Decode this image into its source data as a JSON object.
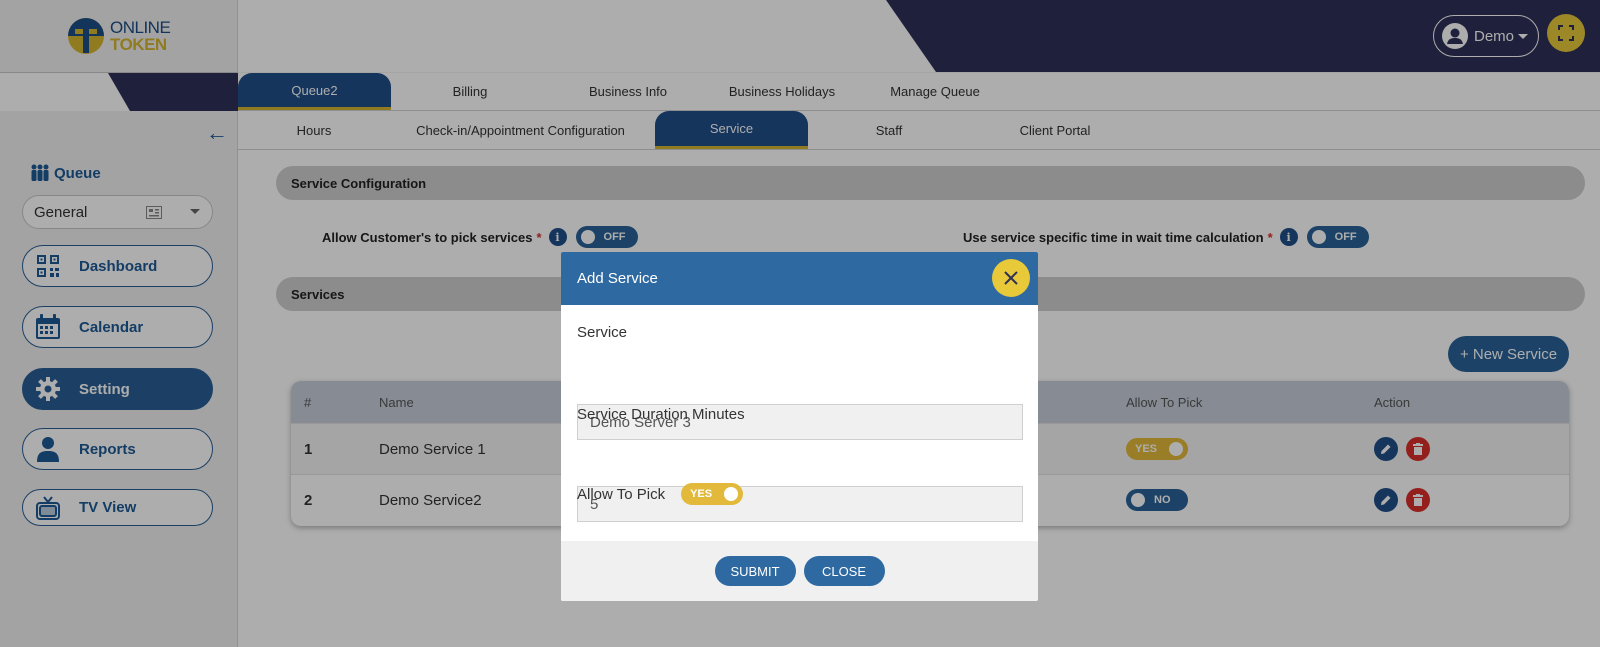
{
  "app": {
    "logo_line1": "ONLINE",
    "logo_line2": "TOKEN",
    "user_name": "Demo"
  },
  "sidebar": {
    "queue_label": "Queue",
    "queue_selected": "General",
    "items": [
      {
        "label": "Dashboard",
        "icon": "qr-code-icon"
      },
      {
        "label": "Calendar",
        "icon": "calendar-icon"
      },
      {
        "label": "Setting",
        "icon": "gear-icon",
        "active": true
      },
      {
        "label": "Reports",
        "icon": "person-icon"
      },
      {
        "label": "TV View",
        "icon": "tv-icon"
      }
    ]
  },
  "tabs_primary": [
    "Queue2",
    "Billing",
    "Business Info",
    "Business Holidays",
    "Manage Queue"
  ],
  "tabs_secondary": [
    "Hours",
    "Check-in/Appointment Configuration",
    "Service",
    "Staff",
    "Client Portal"
  ],
  "service_config": {
    "title": "Service Configuration",
    "allow_pick_label": "Allow Customer's to pick services",
    "allow_pick_state": "OFF",
    "wait_time_label": "Use service specific time in wait time calculation",
    "wait_time_state": "OFF",
    "required_mark": "*",
    "info_glyph": "i"
  },
  "services": {
    "title": "Services",
    "new_button": "+ New Service",
    "columns": [
      "#",
      "Name",
      "Allow To Pick",
      "Action"
    ],
    "rows": [
      {
        "num": "1",
        "name": "Demo Service 1",
        "allow": "YES"
      },
      {
        "num": "2",
        "name": "Demo Service2",
        "allow": "NO"
      }
    ]
  },
  "modal": {
    "title": "Add Service",
    "service_label": "Service",
    "service_value": "Demo Server 3",
    "duration_label": "Service Duration Minutes",
    "duration_value": "5",
    "allow_label": "Allow To Pick",
    "allow_state": "YES",
    "submit": "SUBMIT",
    "close": "CLOSE"
  },
  "colors": {
    "navy": "#2e3057",
    "primary": "#2a6399",
    "accent": "#e7c93a",
    "danger": "#d9302b"
  }
}
